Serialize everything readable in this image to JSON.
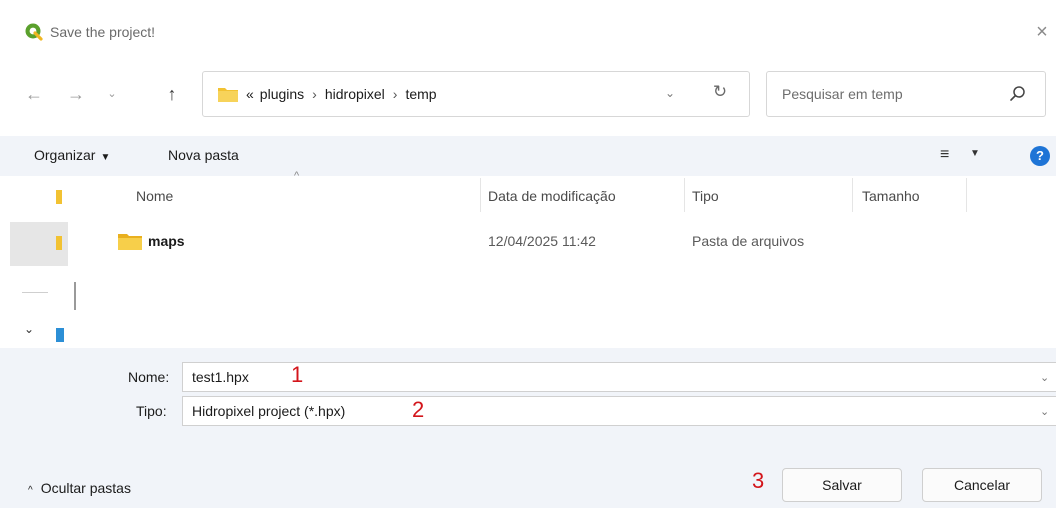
{
  "window": {
    "title": "Save the project!",
    "close_icon": "×"
  },
  "nav": {
    "back_icon": "←",
    "forward_icon": "→",
    "recent_icon": "⌄",
    "up_icon": "↑"
  },
  "address": {
    "overflow": "«",
    "crumbs": [
      "plugins",
      "hidropixel",
      "temp"
    ],
    "separator": "›",
    "dropdown_icon": "⌄",
    "refresh_icon": "↻"
  },
  "search": {
    "placeholder": "Pesquisar em temp"
  },
  "commandbar": {
    "organize_label": "Organizar",
    "organize_caret": "▼",
    "new_folder_label": "Nova pasta",
    "view_icon": "≡",
    "view_caret": "▼",
    "help_icon": "?"
  },
  "navpane": {
    "chevron": "⌄"
  },
  "list": {
    "columns": {
      "name": "Nome",
      "date": "Data de modificação",
      "type": "Tipo",
      "size": "Tamanho"
    },
    "sort_arrow": "^",
    "rows": [
      {
        "name": "maps",
        "date": "12/04/2025 11:42",
        "type": "Pasta de arquivos"
      }
    ]
  },
  "form": {
    "name_label": "Nome:",
    "name_value": "test1.hpx",
    "type_label": "Tipo:",
    "type_value": "Hidropixel project (*.hpx)",
    "caret": "⌄"
  },
  "annotations": [
    "1",
    "2",
    "3"
  ],
  "footer": {
    "hide_folders_caret": "^",
    "hide_folders_label": "Ocultar pastas",
    "save_label": "Salvar",
    "cancel_label": "Cancelar"
  },
  "colors": {
    "accent": "#1e74d6",
    "folder": "#f2c232",
    "annotation": "#d3151b",
    "panel": "#f1f4f9"
  }
}
